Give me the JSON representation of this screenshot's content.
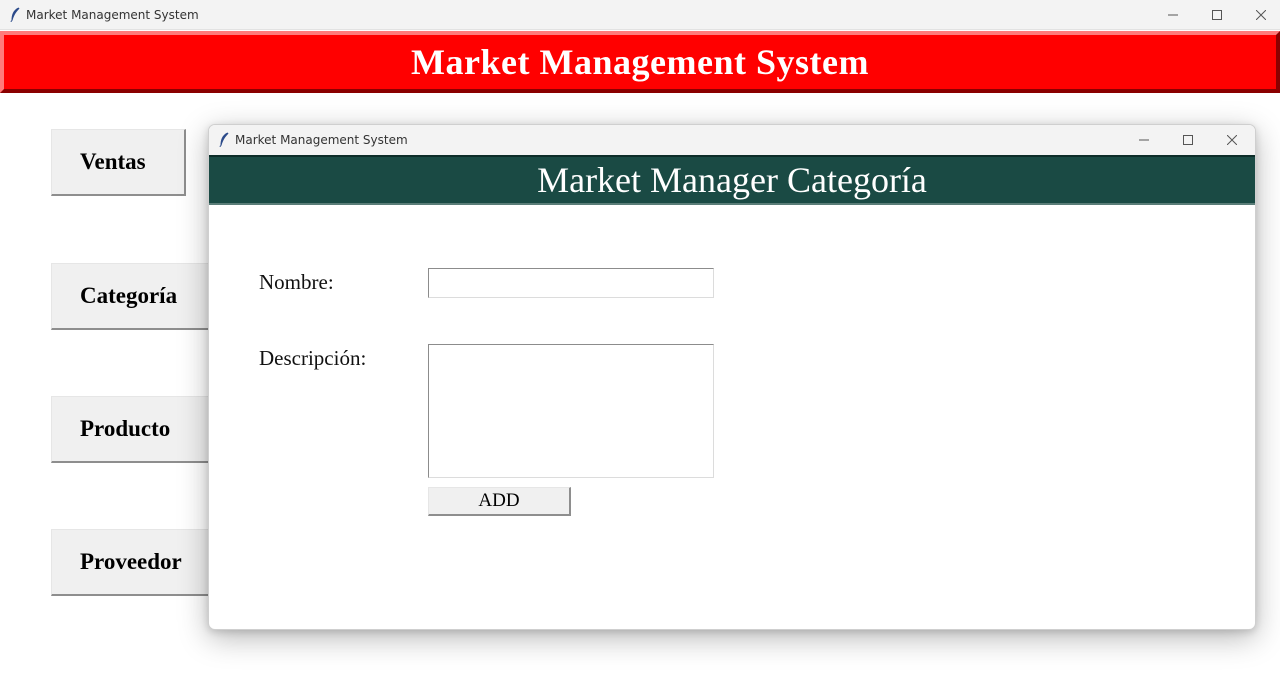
{
  "window": {
    "title": "Market Management System",
    "icon": "feather-icon"
  },
  "main_header": {
    "title": "Market Management System",
    "color": "#ff0000"
  },
  "sidebar": {
    "items": [
      {
        "label": "Ventas"
      },
      {
        "label": "Categoría"
      },
      {
        "label": "Producto"
      },
      {
        "label": "Proveedor"
      }
    ]
  },
  "dialog": {
    "window_title": "Market Management System",
    "header": "Market Manager Categoría",
    "header_color": "#1a4a44",
    "form": {
      "nombre_label": "Nombre:",
      "nombre_value": "",
      "descripcion_label": "Descripción:",
      "descripcion_value": "",
      "add_label": "ADD"
    }
  }
}
